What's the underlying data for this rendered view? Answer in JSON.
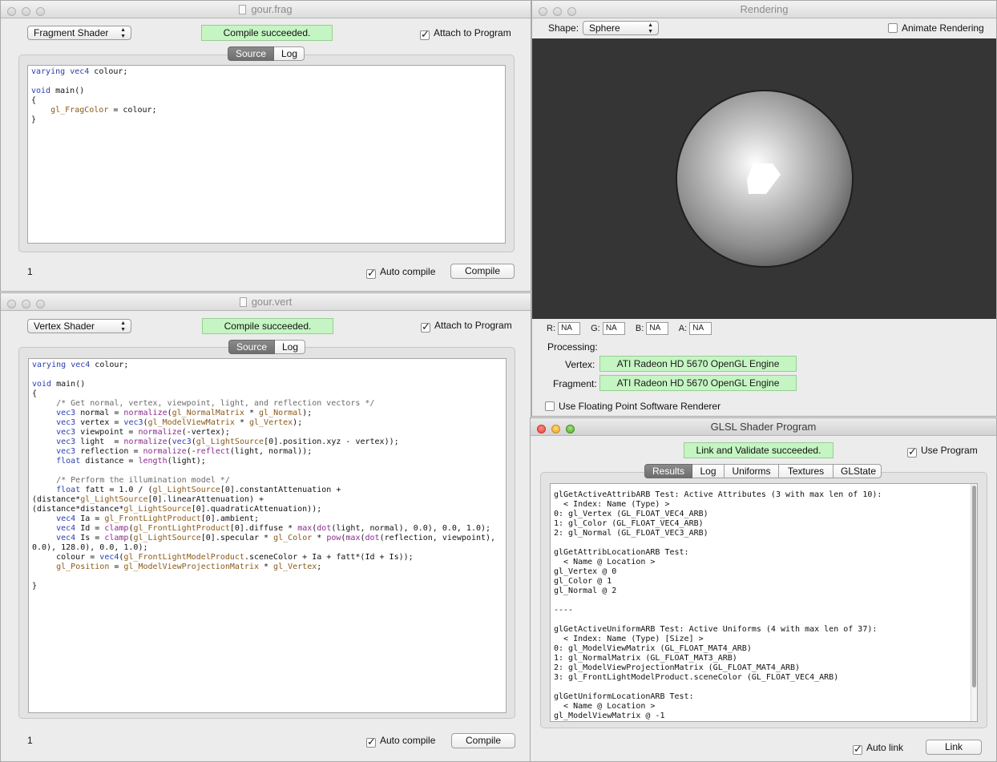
{
  "frag_window": {
    "title": "gour.frag",
    "shader_type": "Fragment Shader",
    "status": "Compile succeeded.",
    "attach_label": "Attach to Program",
    "tabs": [
      "Source",
      "Log"
    ],
    "code_lines": [
      "varying vec4 colour;",
      "",
      "void main()",
      "{",
      "    gl_FragColor = colour;",
      "}"
    ],
    "line_number": "1",
    "auto_compile_label": "Auto compile",
    "compile_label": "Compile"
  },
  "vert_window": {
    "title": "gour.vert",
    "shader_type": "Vertex Shader",
    "status": "Compile succeeded.",
    "attach_label": "Attach to Program",
    "tabs": [
      "Source",
      "Log"
    ],
    "code_lines": [
      "varying vec4 colour;",
      "",
      "void main()",
      "{",
      "     /* Get normal, vertex, viewpoint, light, and reflection vectors */",
      "     vec3 normal = normalize(gl_NormalMatrix * gl_Normal);",
      "     vec3 vertex = vec3(gl_ModelViewMatrix * gl_Vertex);",
      "     vec3 viewpoint = normalize(-vertex);",
      "     vec3 light  = normalize(vec3(gl_LightSource[0].position.xyz - vertex));",
      "     vec3 reflection = normalize(-reflect(light, normal));",
      "     float distance = length(light);",
      "",
      "     /* Perform the illumination model */",
      "     float fatt = 1.0 / (gl_LightSource[0].constantAttenuation +",
      "(distance*gl_LightSource[0].linearAttenuation) +",
      "(distance*distance*gl_LightSource[0].quadraticAttenuation));",
      "     vec4 Ia = gl_FrontLightProduct[0].ambient;",
      "     vec4 Id = clamp(gl_FrontLightProduct[0].diffuse * max(dot(light, normal), 0.0), 0.0, 1.0);",
      "     vec4 Is = clamp(gl_LightSource[0].specular * gl_Color * pow(max(dot(reflection, viewpoint),",
      "0.0), 128.0), 0.0, 1.0);",
      "     colour = vec4(gl_FrontLightModelProduct.sceneColor + Ia + fatt*(Id + Is));",
      "     gl_Position = gl_ModelViewProjectionMatrix * gl_Vertex;",
      "",
      "}"
    ],
    "line_number": "1",
    "auto_compile_label": "Auto compile",
    "compile_label": "Compile"
  },
  "render_window": {
    "title": "Rendering",
    "shape_label": "Shape:",
    "shape_value": "Sphere",
    "animate_label": "Animate Rendering",
    "rgba": [
      {
        "label": "R:",
        "value": "NA"
      },
      {
        "label": "G:",
        "value": "NA"
      },
      {
        "label": "B:",
        "value": "NA"
      },
      {
        "label": "A:",
        "value": "NA"
      }
    ],
    "processing_label": "Processing:",
    "vertex_label": "Vertex:",
    "vertex_engine": "ATI Radeon HD 5670 OpenGL Engine",
    "fragment_label": "Fragment:",
    "fragment_engine": "ATI Radeon HD 5670 OpenGL Engine",
    "fp_label": "Use Floating Point Software Renderer",
    "viewport_bg": "#353535"
  },
  "program_window": {
    "title": "GLSL Shader Program",
    "status": "Link and Validate succeeded.",
    "use_program_label": "Use Program",
    "tabs": [
      "Results",
      "Log",
      "Uniforms",
      "Textures",
      "GLState"
    ],
    "results_lines": [
      "glGetActiveAttribARB Test: Active Attributes (3 with max len of 10):",
      "  < Index: Name (Type) >",
      "0: gl_Vertex (GL_FLOAT_VEC4_ARB)",
      "1: gl_Color (GL_FLOAT_VEC4_ARB)",
      "2: gl_Normal (GL_FLOAT_VEC3_ARB)",
      "",
      "glGetAttribLocationARB Test:",
      "  < Name @ Location >",
      "gl_Vertex @ 0",
      "gl_Color @ 1",
      "gl_Normal @ 2",
      "",
      "----",
      "",
      "glGetActiveUniformARB Test: Active Uniforms (4 with max len of 37):",
      "  < Index: Name (Type) [Size] >",
      "0: gl_ModelViewMatrix (GL_FLOAT_MAT4_ARB)",
      "1: gl_NormalMatrix (GL_FLOAT_MAT3_ARB)",
      "2: gl_ModelViewProjectionMatrix (GL_FLOAT_MAT4_ARB)",
      "3: gl_FrontLightModelProduct.sceneColor (GL_FLOAT_VEC4_ARB)",
      "",
      "glGetUniformLocationARB Test:",
      "  < Name @ Location >",
      "gl_ModelViewMatrix @ -1"
    ],
    "auto_link_label": "Auto link",
    "link_label": "Link"
  }
}
